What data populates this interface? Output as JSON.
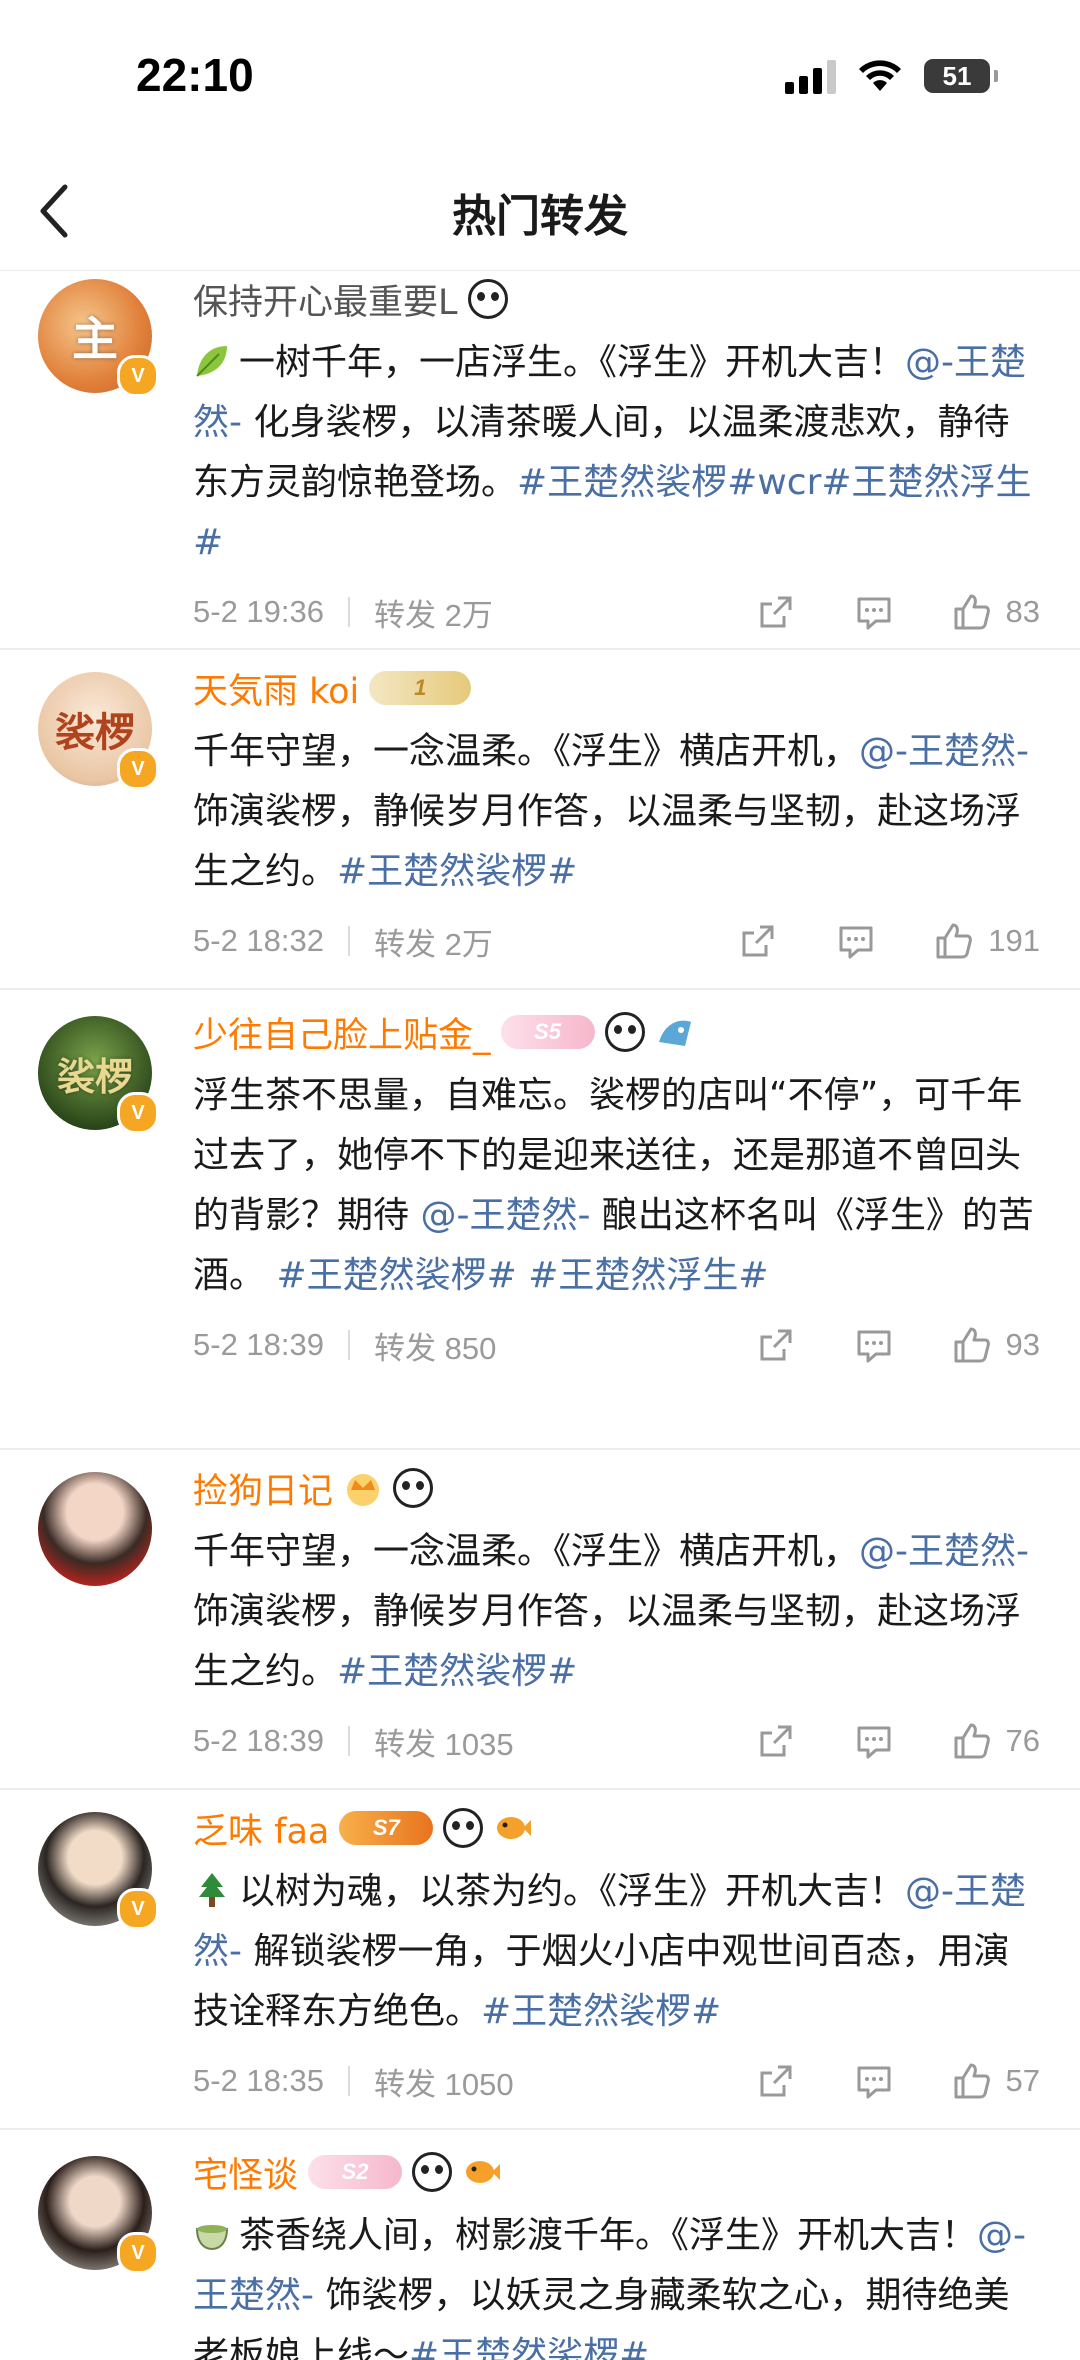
{
  "status_bar": {
    "time": "22:10",
    "battery": "51"
  },
  "nav": {
    "title": "热门转发"
  },
  "posts": [
    {
      "username": "保持开心最重要L",
      "avatar_glyph": "主",
      "text_icon": "leaf-icon",
      "text": "一树千年，一店浮生。《浮生》开机大吉！",
      "mention": "@-王楚然-",
      "text2": " 化身裟椤，以清茶暖人间，以温柔渡悲欢，静待东方灵韵惊艳登场。",
      "tags": "#王楚然裟椤#wcr#王楚然浮生#",
      "date": "5-2 19:36",
      "reposts": "转发 2万",
      "likes": "83"
    },
    {
      "username": "天気雨 koi",
      "avatar_glyph": "裟椤",
      "text": "千年守望，一念温柔。《浮生》横店开机，",
      "mention": "@-王楚然-",
      "text2": " 饰演裟椤，静候岁月作答，以温柔与坚韧，赴这场浮生之约。",
      "tags": "#王楚然裟椤#",
      "date": "5-2 18:32",
      "reposts": "转发 2万",
      "likes": "191",
      "badge": "1"
    },
    {
      "username": "少往自己脸上贴金_",
      "avatar_glyph": "裟椤",
      "text": "浮生茶不思量，自难忘。裟椤的店叫“不停”，可千年过去了，她停不下的是迎来送往，还是那道不曾回头的背影？期待 ",
      "mention": "@-王楚然-",
      "text2": " 酿出这杯名叫《浮生》的苦酒。 ",
      "tags": "#王楚然裟椤# #王楚然浮生#",
      "date": "5-2 18:39",
      "reposts": "转发 850",
      "likes": "93",
      "badge": "S5"
    },
    {
      "username": "捡狗日记",
      "avatar_glyph": "",
      "text": "千年守望，一念温柔。《浮生》横店开机，",
      "mention": "@-王楚然-",
      "text2": " 饰演裟椤，静候岁月作答，以温柔与坚韧，赴这场浮生之约。",
      "tags": "#王楚然裟椤#",
      "date": "5-2 18:39",
      "reposts": "转发 1035",
      "likes": "76"
    },
    {
      "username": "乏味 faa",
      "avatar_glyph": "",
      "text_icon": "tree-icon",
      "text": "以树为魂，以茶为约。《浮生》开机大吉！",
      "mention": "@-王楚然-",
      "text2": " 解锁裟椤一角，于烟火小店中观世间百态，用演技诠释东方绝色。",
      "tags": "#王楚然裟椤#",
      "date": "5-2 18:35",
      "reposts": "转发 1050",
      "likes": "57",
      "badge": "S7"
    },
    {
      "username": "宅怪谈",
      "avatar_glyph": "",
      "text_icon": "tea-icon",
      "text": "茶香绕人间，树影渡千年。《浮生》开机大吉！",
      "mention": "@-王楚然-",
      "text2": " 饰裟椤，以妖灵之身藏柔软之心，期待绝美老板娘上线～",
      "tags": "#王楚然裟椤#",
      "badge": "S2"
    }
  ],
  "colors": {
    "username": "#ff7a00",
    "link": "#4a6fa5",
    "meta": "#9a9a9a"
  }
}
